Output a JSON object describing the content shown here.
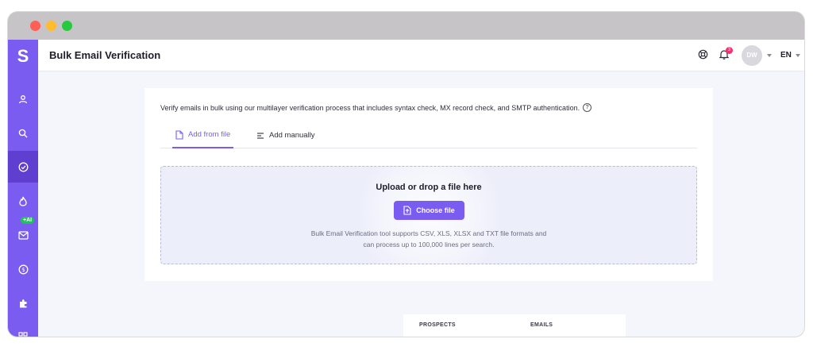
{
  "app": {
    "logo": "S",
    "page_title": "Bulk Email Verification"
  },
  "sidebar": {
    "items": [
      {
        "name": "user-icon",
        "active": false
      },
      {
        "name": "search-icon",
        "active": false
      },
      {
        "name": "check-circle-icon",
        "active": true
      },
      {
        "name": "flame-icon",
        "active": false
      },
      {
        "name": "mail-icon",
        "active": false,
        "badge": "+AI"
      },
      {
        "name": "dollar-icon",
        "active": false
      },
      {
        "name": "puzzle-icon",
        "active": false
      },
      {
        "name": "grid-icon",
        "active": false
      }
    ]
  },
  "header": {
    "notifications_count": "3",
    "avatar_initials": "DW",
    "language": "EN"
  },
  "main": {
    "intro": "Verify emails in bulk using our multilayer verification process that includes syntax check, MX record check, and SMTP authentication.",
    "help_glyph": "?",
    "tabs": [
      {
        "label": "Add from file",
        "active": true
      },
      {
        "label": "Add manually",
        "active": false
      }
    ],
    "dropzone": {
      "title": "Upload or drop a file here",
      "button_label": "Choose file",
      "line1": "Bulk Email Verification tool supports CSV, XLS, XLSX and TXT file formats and",
      "line2": "can process up to 100,000 lines per search."
    }
  },
  "table": {
    "columns": [
      "PROSPECTS",
      "EMAILS"
    ]
  },
  "colors": {
    "accent": "#7b5cf0",
    "sidebar_active": "#5e3fcf",
    "notification": "#f0326e",
    "ai_badge": "#1fc25b"
  }
}
